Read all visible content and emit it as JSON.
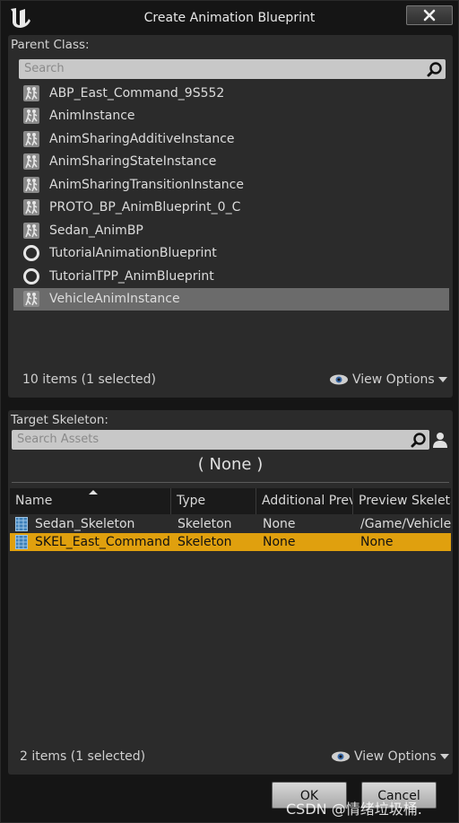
{
  "window": {
    "title": "Create Animation Blueprint"
  },
  "parent_class": {
    "label": "Parent Class:",
    "search_placeholder": "Search",
    "items": [
      {
        "label": "ABP_East_Command_9S552",
        "icon": "anim-blueprint-icon"
      },
      {
        "label": "AnimInstance",
        "icon": "anim-blueprint-icon"
      },
      {
        "label": "AnimSharingAdditiveInstance",
        "icon": "anim-blueprint-icon"
      },
      {
        "label": "AnimSharingStateInstance",
        "icon": "anim-blueprint-icon"
      },
      {
        "label": "AnimSharingTransitionInstance",
        "icon": "anim-blueprint-icon"
      },
      {
        "label": "PROTO_BP_AnimBlueprint_0_C",
        "icon": "anim-blueprint-icon"
      },
      {
        "label": "Sedan_AnimBP",
        "icon": "anim-blueprint-icon"
      },
      {
        "label": "TutorialAnimationBlueprint",
        "icon": "circle-icon"
      },
      {
        "label": "TutorialTPP_AnimBlueprint",
        "icon": "circle-icon"
      },
      {
        "label": "VehicleAnimInstance",
        "icon": "anim-blueprint-icon"
      }
    ],
    "selected_index": 9,
    "status": "10 items (1 selected)",
    "view_options": "View Options"
  },
  "target_skeleton": {
    "label": "Target Skeleton:",
    "search_placeholder": "Search Assets",
    "selected_display": "( None )",
    "columns": [
      "Name",
      "Type",
      "Additional Prev",
      "Preview Skeleta"
    ],
    "rows": [
      {
        "name": "Sedan_Skeleton",
        "type": "Skeleton",
        "additional": "None",
        "preview": "/Game/Vehicle"
      },
      {
        "name": "SKEL_East_Command",
        "type": "Skeleton",
        "additional": "None",
        "preview": "None"
      }
    ],
    "selected_row": 1,
    "status": "2 items (1 selected)",
    "view_options": "View Options"
  },
  "buttons": {
    "ok": "OK",
    "cancel": "Cancel"
  },
  "watermark": "CSDN @情绪垃圾桶.",
  "colors": {
    "selection_highlight": "#e0a00e",
    "list_selection": "#6b6b6b",
    "panel": "#2b2b2b"
  }
}
